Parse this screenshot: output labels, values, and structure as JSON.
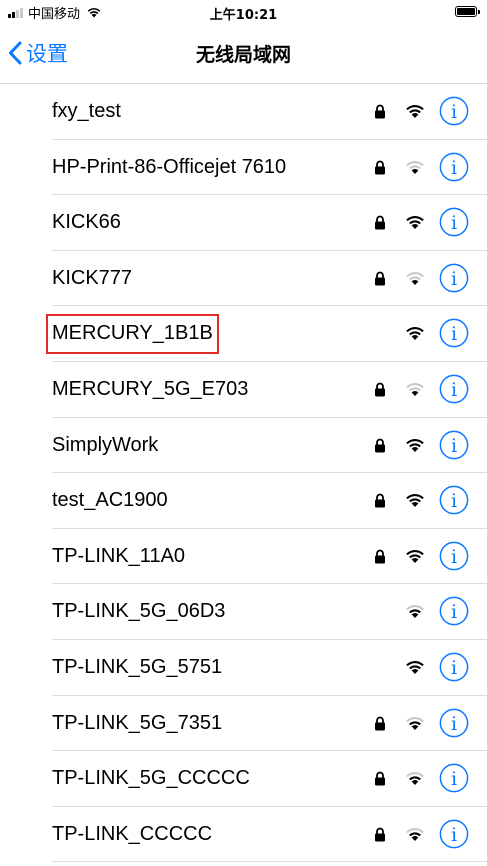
{
  "status_bar": {
    "carrier": "中国移动",
    "time": "上午10:21",
    "signal_bars": 4,
    "signal_bars_filled": 2,
    "battery_level": 1.0
  },
  "nav": {
    "back_label": "设置",
    "title": "无线局域网"
  },
  "colors": {
    "accent": "#0a7aff",
    "highlight": "#e32a2a",
    "wifi_weak": "#c7c7cc"
  },
  "icons": {
    "lock": "lock-icon",
    "wifi": "wifi-icon",
    "info": "info-icon",
    "back": "chevron-left-icon"
  },
  "networks": [
    {
      "name": "fxy_test",
      "locked": true,
      "signal": 3
    },
    {
      "name": "HP-Print-86-Officejet 7610",
      "locked": true,
      "signal": 1
    },
    {
      "name": "KICK66",
      "locked": true,
      "signal": 3
    },
    {
      "name": "KICK777",
      "locked": true,
      "signal": 1
    },
    {
      "name": "MERCURY_1B1B",
      "locked": false,
      "signal": 3,
      "highlighted": true
    },
    {
      "name": "MERCURY_5G_E703",
      "locked": true,
      "signal": 1
    },
    {
      "name": "SimplyWork",
      "locked": true,
      "signal": 3
    },
    {
      "name": "test_AC1900",
      "locked": true,
      "signal": 3
    },
    {
      "name": "TP-LINK_11A0",
      "locked": true,
      "signal": 3
    },
    {
      "name": "TP-LINK_5G_06D3",
      "locked": false,
      "signal": 2
    },
    {
      "name": "TP-LINK_5G_5751",
      "locked": false,
      "signal": 3
    },
    {
      "name": "TP-LINK_5G_7351",
      "locked": true,
      "signal": 2
    },
    {
      "name": "TP-LINK_5G_CCCCC",
      "locked": true,
      "signal": 2
    },
    {
      "name": "TP-LINK_CCCCC",
      "locked": true,
      "signal": 2
    }
  ]
}
